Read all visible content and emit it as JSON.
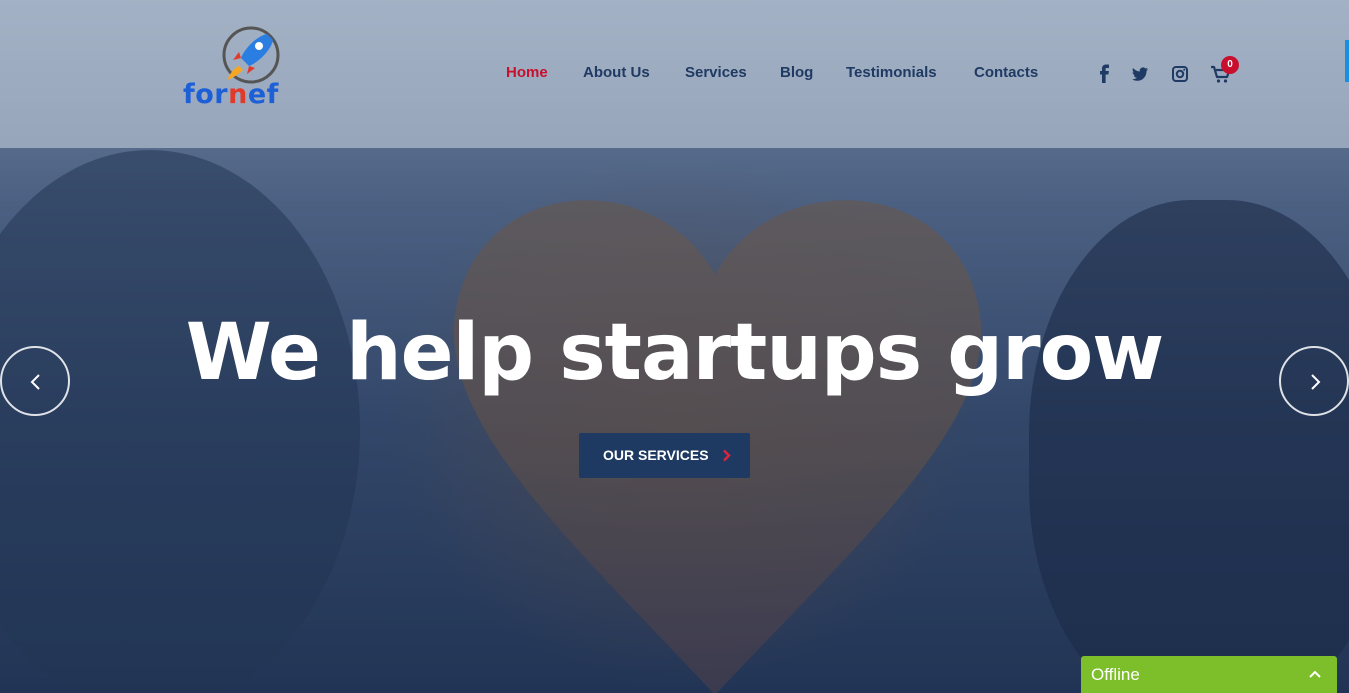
{
  "brand": {
    "logo_text_blue": "for",
    "logo_text_red": "n",
    "logo_text_blue2": "ef"
  },
  "nav": [
    {
      "label": "Home",
      "active": true
    },
    {
      "label": "About Us"
    },
    {
      "label": "Services"
    },
    {
      "label": "Blog"
    },
    {
      "label": "Testimonials"
    },
    {
      "label": "Contacts"
    }
  ],
  "social": [
    "facebook-icon",
    "twitter-icon",
    "instagram-icon"
  ],
  "cart": {
    "count": "0"
  },
  "hero": {
    "headline": "We help startups grow",
    "cta_label": "OUR SERVICES"
  },
  "chat": {
    "status": "Offline"
  },
  "colors": {
    "nav_text": "#1f3a63",
    "nav_active": "#c8102e",
    "cta_bg": "#1e3a63",
    "chat_bg": "#7cbf2a"
  }
}
